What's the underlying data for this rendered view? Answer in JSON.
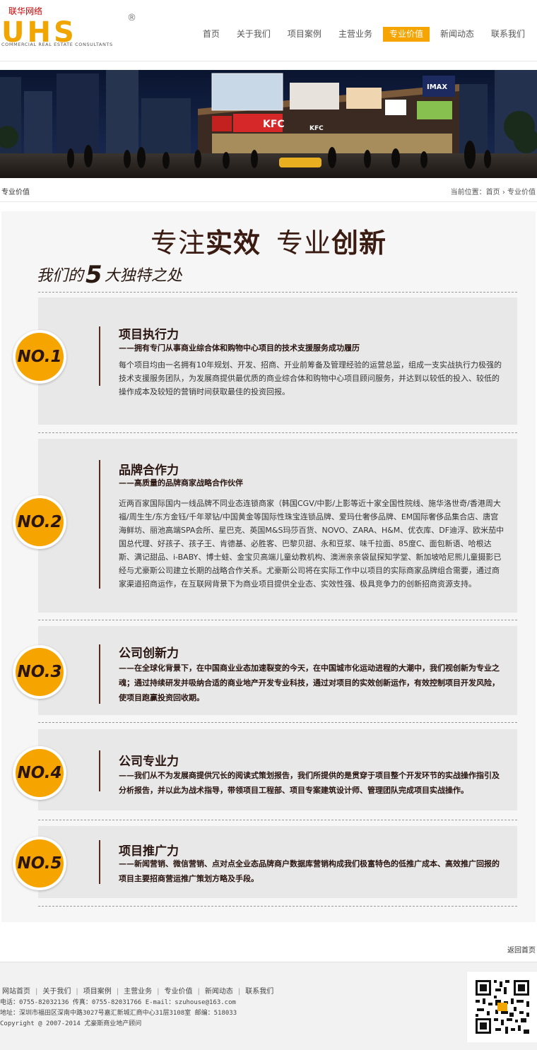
{
  "header": {
    "top_note": "联华网络",
    "logo_mark": "UHS",
    "logo_reg": "®",
    "logo_sub": "COMMERCIAL REAL ESTATE CONSULTANTS",
    "nav": [
      {
        "label": "首页",
        "active": false
      },
      {
        "label": "关于我们",
        "active": false
      },
      {
        "label": "项目案例",
        "active": false
      },
      {
        "label": "主营业务",
        "active": false
      },
      {
        "label": "专业价值",
        "active": true
      },
      {
        "label": "新闻动态",
        "active": false
      },
      {
        "label": "联系我们",
        "active": false
      }
    ]
  },
  "banner": {
    "signs": [
      "KFC",
      "KFC",
      "IMAX"
    ]
  },
  "breadcrumb": {
    "section": "专业价值",
    "prefix": "当前位置：",
    "home": "首页",
    "arrow": "›",
    "current": "专业价值"
  },
  "content": {
    "slogan_a": "专注",
    "slogan_b": "实效",
    "slogan_c": "专业",
    "slogan_d": "创新",
    "tagline_a": "我们的",
    "tagline_num": "5",
    "tagline_b": "大独特之处",
    "items": [
      {
        "badge": "NO.1",
        "title": "项目执行力",
        "subtitle": "——拥有专门从事商业综合体和购物中心项目的技术支援服务成功履历",
        "body": "每个项目均由一名拥有10年规划、开发、招商、开业前筹备及管理经验的运营总监，组成一支实战执行力极强的技术支援服务团队，为发展商提供最优质的商业综合体和购物中心项目顾问服务，并达到以较低的投入、较低的操作成本及较短的营销时间获取最佳的投资回报。"
      },
      {
        "badge": "NO.2",
        "title": "品牌合作力",
        "subtitle": "——高质量的品牌商家战略合作伙伴",
        "body": "近两百家国际国内一线品牌不同业态连锁商家（韩国CGV/中影/上影等近十家全国性院线、施华洛世奇/香港周大福/周生生/东方金钰/千年翠钻/中国黄金等国际性珠宝连锁品牌、爱玛仕奢侈品牌、EM国际奢侈品集合店、唐宫海鲜坊、丽池高端SPA会所、星巴克、英国M&S玛莎百货、NOVO、ZARA、H&M、优衣库、DF迪浮、欧米茄中国总代理、好孩子、孩子王、肯德基、必胜客、巴黎贝甜、永和豆浆、味千拉面、85度C、面包新语、哈根达斯、满记甜品、i-BABY、博士蛙、金宝贝高端儿童幼教机构、澳洲亲亲袋鼠探知学堂、新加坡哈尼熊儿童摄影已经与尤豪斯公司建立长期的战略合作关系。尤豪斯公司将在实际工作中以项目的实际商家品牌组合需要，通过商家渠道招商运作，在互联网背景下为商业项目提供全业态、实效性强、极具竞争力的创新招商资源支持。"
      },
      {
        "badge": "NO.3",
        "title": "公司创新力",
        "subtitle": "",
        "body": "——在全球化背景下，在中国商业业态加速裂变的今天，在中国城市化运动进程的大潮中，我们视创新为专业之魂；通过持续研发并吸纳合适的商业地产开发专业科技，通过对项目的实效创新运作，有效控制项目开发风险，使项目跑赢投资回收期。"
      },
      {
        "badge": "NO.4",
        "title": "公司专业力",
        "subtitle": "",
        "body": "——我们从不为发展商提供冗长的阅读式策划报告，我们所提供的是贯穿于项目整个开发环节的实战操作指引及分析报告，并以此为战术指导，带领项目工程部、项目专案建筑设计师、管理团队完成项目实战操作。"
      },
      {
        "badge": "NO.5",
        "title": "项目推广力",
        "subtitle": "",
        "body": "——新闻营销、微信营销、点对点全业态品牌商户数据库营销构成我们极富特色的低推广成本、高效推广回报的项目主要招商营运推广策划方略及手段。"
      }
    ]
  },
  "back_to_home": "返回首页",
  "footer": {
    "links": [
      "网站首页",
      "关于我们",
      "项目案例",
      "主营业务",
      "专业价值",
      "新闻动态",
      "联系我们"
    ],
    "separator": "|",
    "phone": "电话：0755-82032136 传真：0755-82031766 E-mail：szuhouse@163.com",
    "address": "地址：深圳市福田区深南中路3027号嘉汇新城汇商中心31层3108室 邮编：518033",
    "copyright": "Copyright @ 2007-2014 尤豪斯商业地产顾问"
  }
}
